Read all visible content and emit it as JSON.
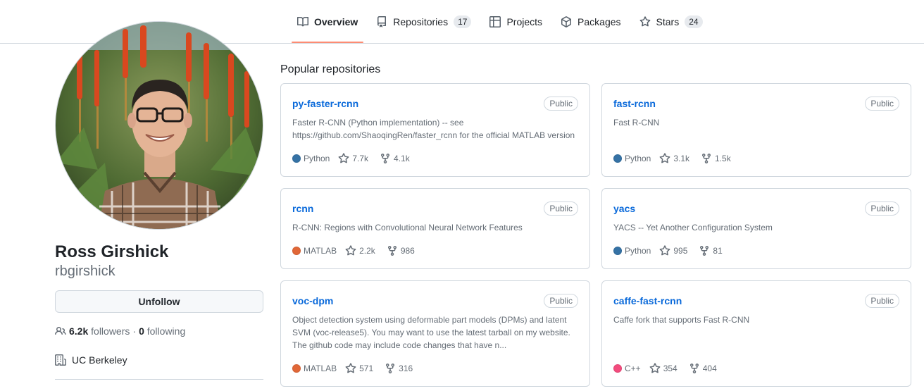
{
  "nav": {
    "tabs": [
      {
        "label": "Overview",
        "icon": "book-icon",
        "count": ""
      },
      {
        "label": "Repositories",
        "icon": "repo-icon",
        "count": "17"
      },
      {
        "label": "Projects",
        "icon": "table-icon",
        "count": ""
      },
      {
        "label": "Packages",
        "icon": "package-icon",
        "count": ""
      },
      {
        "label": "Stars",
        "icon": "star-icon",
        "count": "24"
      }
    ],
    "selected": "Overview",
    "selected_underline_color": "#fd8c73"
  },
  "profile": {
    "name": "Ross Girshick",
    "login": "rbgirshick",
    "follow_button": "Unfollow",
    "followers_count": "6.2k",
    "followers_label": "followers",
    "separator": "·",
    "following_count": "0",
    "following_label": "following",
    "organization": "UC Berkeley"
  },
  "popular": {
    "title": "Popular repositories",
    "repos": [
      {
        "name": "py-faster-rcnn",
        "visibility": "Public",
        "description": "Faster R-CNN (Python implementation) -- see https://github.com/ShaoqingRen/faster_rcnn for the official MATLAB version",
        "language": "Python",
        "lang_color": "#3572A5",
        "stars": "7.7k",
        "forks": "4.1k"
      },
      {
        "name": "fast-rcnn",
        "visibility": "Public",
        "description": "Fast R-CNN",
        "language": "Python",
        "lang_color": "#3572A5",
        "stars": "3.1k",
        "forks": "1.5k"
      },
      {
        "name": "rcnn",
        "visibility": "Public",
        "description": "R-CNN: Regions with Convolutional Neural Network Features",
        "language": "MATLAB",
        "lang_color": "#e16737",
        "stars": "2.2k",
        "forks": "986"
      },
      {
        "name": "yacs",
        "visibility": "Public",
        "description": "YACS -- Yet Another Configuration System",
        "language": "Python",
        "lang_color": "#3572A5",
        "stars": "995",
        "forks": "81"
      },
      {
        "name": "voc-dpm",
        "visibility": "Public",
        "description": "Object detection system using deformable part models (DPMs) and latent SVM (voc-release5). You may want to use the latest tarball on my website. The github code may include code changes that have n...",
        "language": "MATLAB",
        "lang_color": "#e16737",
        "stars": "571",
        "forks": "316"
      },
      {
        "name": "caffe-fast-rcnn",
        "visibility": "Public",
        "description": "Caffe fork that supports Fast R-CNN",
        "language": "C++",
        "lang_color": "#f34b7d",
        "stars": "354",
        "forks": "404"
      }
    ]
  },
  "colors": {
    "link": "#0969da",
    "muted": "#656d76",
    "border": "#d0d7de"
  }
}
